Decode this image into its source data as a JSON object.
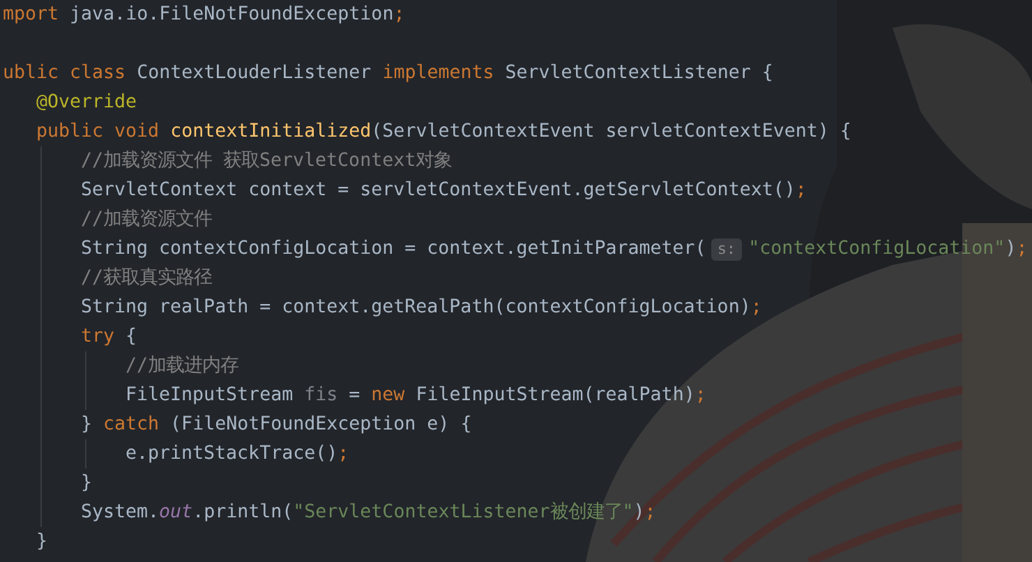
{
  "code_lines": [
    {
      "kind": "code",
      "tokens": [
        {
          "kind": "keyword",
          "text": "mport"
        },
        {
          "kind": "plain",
          "text": " java.io.FileNotFoundException"
        },
        {
          "kind": "keyword",
          "text": ";"
        }
      ]
    },
    {
      "kind": "blank"
    },
    {
      "kind": "code",
      "tokens": [
        {
          "kind": "keyword",
          "text": "ublic class"
        },
        {
          "kind": "plain",
          "text": " ContextLouderListener "
        },
        {
          "kind": "keyword",
          "text": "implements"
        },
        {
          "kind": "plain",
          "text": " ServletContextListener {"
        }
      ],
      "children": [
        {
          "kind": "code",
          "tokens": [
            {
              "kind": "annotation",
              "text": "@Override"
            }
          ]
        },
        {
          "kind": "code",
          "tokens": [
            {
              "kind": "keyword",
              "text": "public void"
            },
            {
              "kind": "method",
              "text": " contextInitialized"
            },
            {
              "kind": "plain",
              "text": "(ServletContextEvent servletContextEvent) {"
            }
          ],
          "children": [
            {
              "kind": "code",
              "tokens": [
                {
                  "kind": "comment",
                  "text": "//加载资源文件 获取ServletContext对象"
                }
              ]
            },
            {
              "kind": "code",
              "tokens": [
                {
                  "kind": "plain",
                  "text": "ServletContext context = servletContextEvent.getServletContext()"
                },
                {
                  "kind": "keyword",
                  "text": ";"
                }
              ]
            },
            {
              "kind": "code",
              "tokens": [
                {
                  "kind": "comment",
                  "text": "//加载资源文件"
                }
              ]
            },
            {
              "kind": "code",
              "tokens": [
                {
                  "kind": "plain",
                  "text": "String contextConfigLocation = context.getInitParameter("
                },
                {
                  "kind": "hint",
                  "text": "s:"
                },
                {
                  "kind": "string",
                  "text": "\"contextConfigLocation\""
                },
                {
                  "kind": "plain",
                  "text": ")"
                },
                {
                  "kind": "keyword",
                  "text": ";"
                }
              ]
            },
            {
              "kind": "code",
              "tokens": [
                {
                  "kind": "comment",
                  "text": "//获取真实路径"
                }
              ]
            },
            {
              "kind": "code",
              "tokens": [
                {
                  "kind": "plain",
                  "text": "String realPath = context.getRealPath(contextConfigLocation)"
                },
                {
                  "kind": "keyword",
                  "text": ";"
                }
              ]
            },
            {
              "kind": "code",
              "tokens": [
                {
                  "kind": "keyword",
                  "text": "try"
                },
                {
                  "kind": "plain",
                  "text": " {"
                }
              ],
              "children": [
                {
                  "kind": "code",
                  "tokens": [
                    {
                      "kind": "comment",
                      "text": "//加载进内存"
                    }
                  ]
                },
                {
                  "kind": "code",
                  "tokens": [
                    {
                      "kind": "plain",
                      "text": "FileInputStream "
                    },
                    {
                      "kind": "unused",
                      "text": "fis"
                    },
                    {
                      "kind": "plain",
                      "text": " = "
                    },
                    {
                      "kind": "keyword",
                      "text": "new"
                    },
                    {
                      "kind": "plain",
                      "text": " FileInputStream(realPath)"
                    },
                    {
                      "kind": "keyword",
                      "text": ";"
                    }
                  ]
                }
              ]
            },
            {
              "kind": "code",
              "tokens": [
                {
                  "kind": "plain",
                  "text": "} "
                },
                {
                  "kind": "keyword",
                  "text": "catch"
                },
                {
                  "kind": "plain",
                  "text": " (FileNotFoundException e) {"
                }
              ],
              "children": [
                {
                  "kind": "code",
                  "tokens": [
                    {
                      "kind": "plain",
                      "text": "e.printStackTrace()"
                    },
                    {
                      "kind": "keyword",
                      "text": ";"
                    }
                  ]
                }
              ]
            },
            {
              "kind": "code",
              "tokens": [
                {
                  "kind": "plain",
                  "text": "}"
                }
              ]
            },
            {
              "kind": "code",
              "tokens": [
                {
                  "kind": "plain",
                  "text": "System."
                },
                {
                  "kind": "static",
                  "text": "out"
                },
                {
                  "kind": "plain",
                  "text": ".println("
                },
                {
                  "kind": "string",
                  "text": "\"ServletContextListener被创建了\""
                },
                {
                  "kind": "plain",
                  "text": ")"
                },
                {
                  "kind": "keyword",
                  "text": ";"
                }
              ]
            }
          ]
        },
        {
          "kind": "code",
          "tokens": [
            {
              "kind": "plain",
              "text": "}"
            }
          ]
        }
      ]
    }
  ]
}
